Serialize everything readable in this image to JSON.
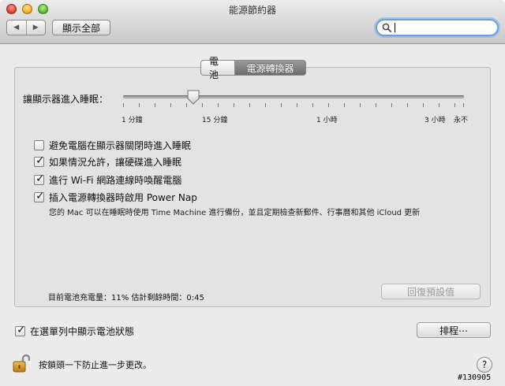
{
  "window": {
    "title": "能源節約器"
  },
  "toolbar": {
    "back_icon": "back-arrow-icon",
    "forward_icon": "forward-arrow-icon",
    "show_all_label": "顯示全部",
    "search": {
      "value": "",
      "placeholder": ""
    }
  },
  "tabs": [
    {
      "label": "電池",
      "selected": false
    },
    {
      "label": "電源轉換器",
      "selected": true
    }
  ],
  "display_sleep": {
    "label": "讓顯示器進入睡眠：",
    "value_minutes": 10,
    "tick_labels": [
      "1 分鐘",
      "15 分鐘",
      "1 小時",
      "3 小時",
      "永不"
    ]
  },
  "options": [
    {
      "label": "避免電腦在顯示器關閉時進入睡眠",
      "checked": false
    },
    {
      "label": "如果情況允許，讓硬碟進入睡眠",
      "checked": true
    },
    {
      "label": "進行 Wi-Fi 網路連線時喚醒電腦",
      "checked": true
    },
    {
      "label": "插入電源轉換器時啟用 Power Nap",
      "checked": true
    }
  ],
  "power_nap_description": "您的 Mac 可以在睡眠時使用 Time Machine 進行備份，並且定期檢查新郵件、行事曆和其他 iCloud 更新",
  "battery_status": "目前電池充電量：11%  估計剩餘時間：0:45",
  "restore_defaults_label": "回復預設值",
  "show_battery_in_menu": {
    "label": "在選單列中顯示電池狀態",
    "checked": true
  },
  "schedule_label": "排程⋯",
  "lock_text": "按鎖頭一下防止進一步更改。",
  "help_label": "?",
  "watermark": "#130905"
}
